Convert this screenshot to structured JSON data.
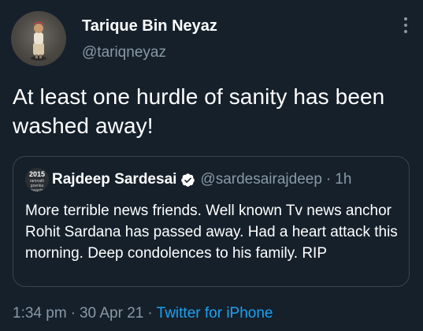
{
  "author": {
    "display_name": "Tarique Bin Neyaz",
    "handle": "@tariqneyaz",
    "avatar_icon": "profile-photo-icon"
  },
  "tweet": {
    "text": "At least one hurdle of sanity has been washed away!"
  },
  "quoted_tweet": {
    "avatar_text": "2015",
    "avatar_subtext": "ramnath goenka awards",
    "display_name": "Rajdeep Sardesai",
    "verified": true,
    "handle": "@sardesairajdeep",
    "separator": "·",
    "time": "1h",
    "text": "More terrible news friends. Well known Tv news anchor Rohit Sardana has passed away. Had a heart attack this morning. Deep condolences to his family. RIP"
  },
  "meta": {
    "time": "1:34 pm",
    "separator": "·",
    "date": "30 Apr 21",
    "source": "Twitter for iPhone"
  },
  "colors": {
    "background": "#15202b",
    "secondary_text": "#8899a6",
    "link": "#1da1f2",
    "border": "#38444d",
    "verified": "#ffffff"
  }
}
